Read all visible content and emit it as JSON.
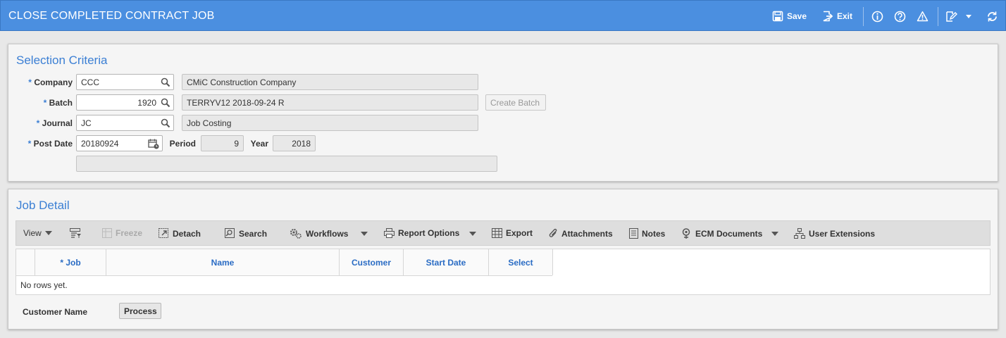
{
  "header": {
    "title": "CLOSE COMPLETED CONTRACT JOB",
    "save_label": "Save",
    "exit_label": "Exit"
  },
  "selection": {
    "title": "Selection Criteria",
    "company_label": "Company",
    "company_value": "CCC",
    "company_desc": "CMiC Construction Company",
    "batch_label": "Batch",
    "batch_value": "1920",
    "batch_desc": "TERRYV12 2018-09-24 R",
    "create_batch_label": "Create Batch",
    "journal_label": "Journal",
    "journal_value": "JC",
    "journal_desc": "Job Costing",
    "post_date_label": "Post Date",
    "post_date_value": "20180924",
    "period_label": "Period",
    "period_value": "9",
    "year_label": "Year",
    "year_value": "2018",
    "extra_value": "",
    "required_marker": "*"
  },
  "job_detail": {
    "title": "Job Detail",
    "toolbar": {
      "view": "View",
      "freeze": "Freeze",
      "detach": "Detach",
      "search": "Search",
      "workflows": "Workflows",
      "report_options": "Report Options",
      "export": "Export",
      "attachments": "Attachments",
      "notes": "Notes",
      "ecm_documents": "ECM Documents",
      "user_extensions": "User Extensions"
    },
    "columns": [
      "* Job",
      "Name",
      "Customer",
      "Start Date",
      "Select"
    ],
    "empty_text": "No rows yet.",
    "customer_name_label": "Customer Name",
    "process_label": "Process"
  },
  "colors": {
    "header_bg": "#4b8fe0",
    "accent": "#3b7fd4"
  }
}
